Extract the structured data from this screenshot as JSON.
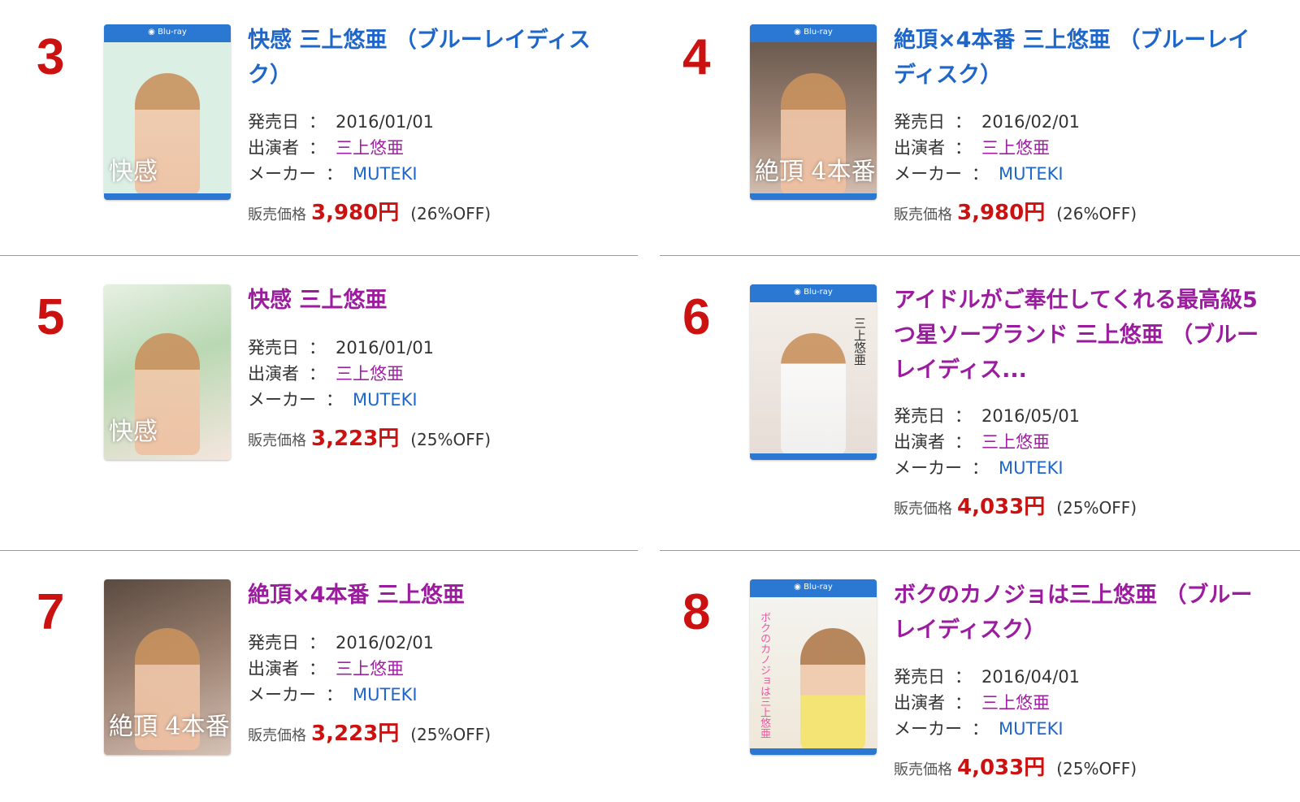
{
  "labels": {
    "release_date": "発売日",
    "performer": "出演者",
    "maker": "メーカー",
    "price": "販売価格",
    "separator": "："
  },
  "items": [
    {
      "rank": "3",
      "title": "快感 三上悠亜 （ブルーレイディスク）",
      "title_color": "#1f66c9",
      "date": "2016/01/01",
      "performer": "三上悠亜",
      "maker": "MUTEKI",
      "price": "3,980円",
      "discount": "(26%OFF)",
      "cover": "bluray",
      "cover_text": "快感"
    },
    {
      "rank": "4",
      "title": "絶頂×4本番 三上悠亜 （ブルーレイディスク）",
      "title_color": "#1f66c9",
      "date": "2016/02/01",
      "performer": "三上悠亜",
      "maker": "MUTEKI",
      "price": "3,980円",
      "discount": "(26%OFF)",
      "cover": "bluray",
      "cover_text": "絶頂 4本番"
    },
    {
      "rank": "5",
      "title": "快感 三上悠亜",
      "title_color": "#9b1c9e",
      "date": "2016/01/01",
      "performer": "三上悠亜",
      "maker": "MUTEKI",
      "price": "3,223円",
      "discount": "(25%OFF)",
      "cover": "dvd",
      "cover_text": "快感"
    },
    {
      "rank": "6",
      "title": "アイドルがご奉仕してくれる最高級5つ星ソープランド 三上悠亜 （ブルーレイディス...",
      "title_color": "#9b1c9e",
      "date": "2016/05/01",
      "performer": "三上悠亜",
      "maker": "MUTEKI",
      "price": "4,033円",
      "discount": "(25%OFF)",
      "cover": "bluray",
      "cover_text": "三上悠亜"
    },
    {
      "rank": "7",
      "title": "絶頂×4本番 三上悠亜",
      "title_color": "#9b1c9e",
      "date": "2016/02/01",
      "performer": "三上悠亜",
      "maker": "MUTEKI",
      "price": "3,223円",
      "discount": "(25%OFF)",
      "cover": "dvd",
      "cover_text": "絶頂 4本番"
    },
    {
      "rank": "8",
      "title": "ボクのカノジョは三上悠亜 （ブルーレイディスク）",
      "title_color": "#9b1c9e",
      "date": "2016/04/01",
      "performer": "三上悠亜",
      "maker": "MUTEKI",
      "price": "4,033円",
      "discount": "(25%OFF)",
      "cover": "bluray",
      "cover_text": "ボクのカノジョは三上悠亜"
    }
  ]
}
